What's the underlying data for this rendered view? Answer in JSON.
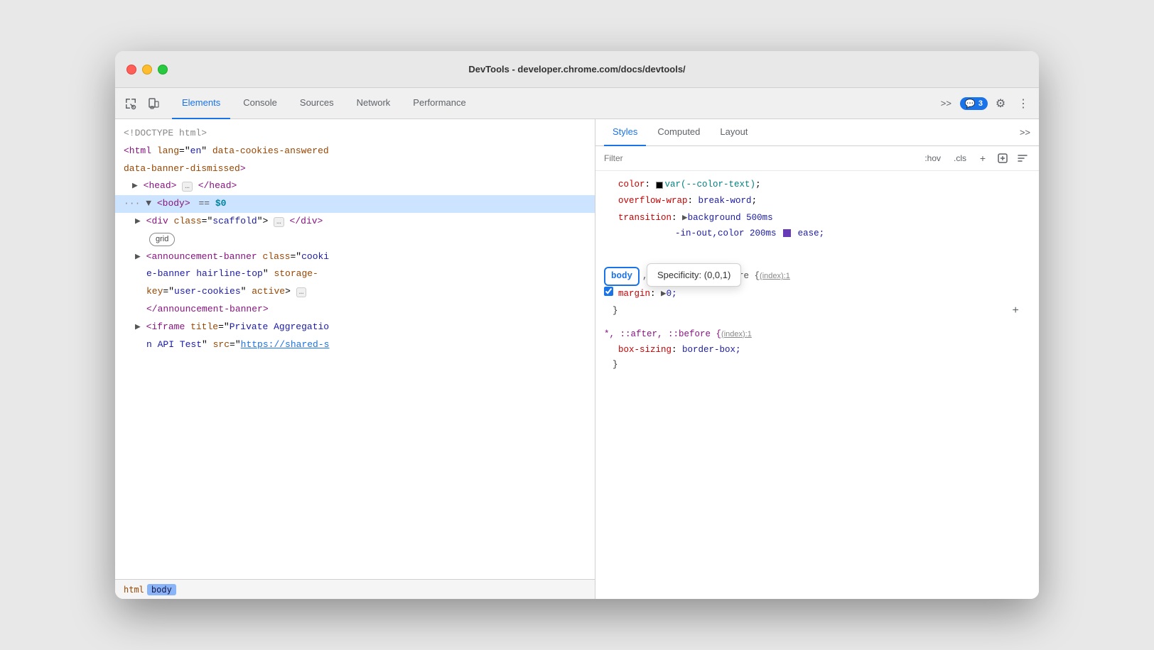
{
  "window": {
    "title": "DevTools - developer.chrome.com/docs/devtools/"
  },
  "toolbar": {
    "tabs": [
      {
        "id": "elements",
        "label": "Elements",
        "active": true
      },
      {
        "id": "console",
        "label": "Console",
        "active": false
      },
      {
        "id": "sources",
        "label": "Sources",
        "active": false
      },
      {
        "id": "network",
        "label": "Network",
        "active": false
      },
      {
        "id": "performance",
        "label": "Performance",
        "active": false
      }
    ],
    "more_label": ">>",
    "badge_count": "3",
    "settings_icon": "⚙",
    "more_icon": "⋮"
  },
  "dom": {
    "lines": [
      {
        "id": "doctype",
        "content": "<!DOCTYPE html>"
      },
      {
        "id": "html-open",
        "content": "<html lang=\"en\" data-cookies-answered"
      },
      {
        "id": "html-cont",
        "content": "data-banner-dismissed>"
      },
      {
        "id": "head",
        "content": "▶ <head> … </head>"
      },
      {
        "id": "body",
        "content": "··· ▼ <body> == $0",
        "selected": true
      },
      {
        "id": "div-scaffold",
        "content": "  ▶ <div class=\"scaffold\"> … </div>"
      },
      {
        "id": "grid-badge",
        "content": "grid"
      },
      {
        "id": "announcement",
        "content": "  ▶ <announcement-banner class=\"cooki"
      },
      {
        "id": "announcement2",
        "content": "    e-banner hairline-top\" storage-"
      },
      {
        "id": "announcement3",
        "content": "    key=\"user-cookies\" active> …"
      },
      {
        "id": "announcement4",
        "content": "    </announcement-banner>"
      },
      {
        "id": "iframe",
        "content": "  ▶ <iframe title=\"Private Aggregatio"
      },
      {
        "id": "iframe2",
        "content": "    n API Test\" src=\"https://shared-s"
      }
    ]
  },
  "breadcrumb": {
    "items": [
      {
        "id": "html",
        "label": "html",
        "active": false
      },
      {
        "id": "body",
        "label": "body",
        "active": true
      }
    ]
  },
  "styles": {
    "tabs": [
      {
        "id": "styles",
        "label": "Styles",
        "active": true
      },
      {
        "id": "computed",
        "label": "Computed",
        "active": false
      },
      {
        "id": "layout",
        "label": "Layout",
        "active": false
      }
    ],
    "filter_placeholder": "Filter",
    "filter_actions": [
      ":hov",
      ".cls"
    ],
    "rules": [
      {
        "id": "rule1",
        "properties": [
          {
            "name": "color",
            "value": "var(--color-text)",
            "has_swatch": true
          },
          {
            "name": "overflow-wrap",
            "value": "break-word"
          },
          {
            "name": "transition",
            "value": "▶ background 500ms -in-out,color 200ms",
            "has_color_checkbox": true,
            "extra": "ease;"
          }
        ]
      },
      {
        "id": "rule2",
        "specificity": "(0,0,1)",
        "selector": "body",
        "selector_extra": ", h1, h2, h3, p, pre {",
        "link": "(index):1",
        "declarations": [
          {
            "name": "margin",
            "value": "▶ 0;",
            "checked": true
          }
        ]
      },
      {
        "id": "rule3",
        "selector": "*, ::after, ::before {",
        "link": "(index):1",
        "declarations": [
          {
            "name": "box-sizing",
            "value": "border-box;"
          }
        ]
      }
    ]
  }
}
